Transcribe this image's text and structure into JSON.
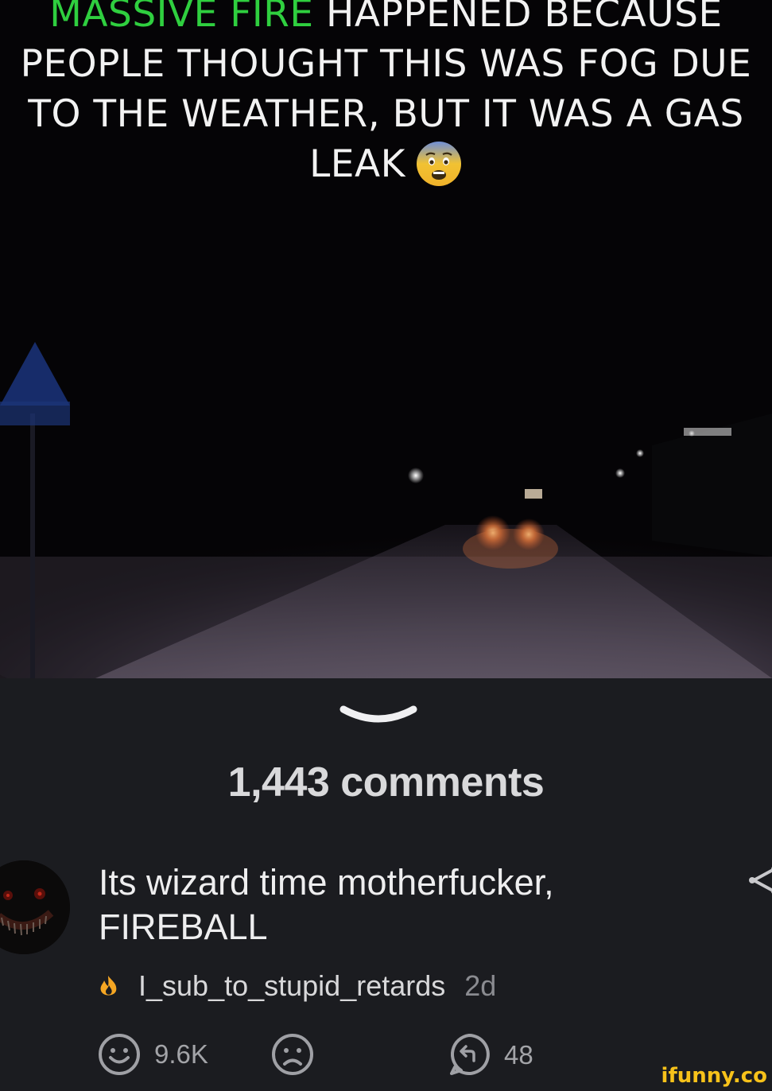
{
  "caption": {
    "line1_green": "MASSIVE FIRE",
    "line1_rest": " HAPPENED BECAUSE",
    "line2": "PEOPLE THOUGHT THIS WAS FOG DUE",
    "line3": "TO THE WEATHER, BUT IT WAS A GAS",
    "line4": "LEAK",
    "emoji": "fearful-face-icon"
  },
  "comments": {
    "count_label": "1,443 comments"
  },
  "comment": {
    "text_line1": "Its wizard time motherfucker,",
    "text_line2": "FIREBALL",
    "username": "I_sub_to_stupid_retards",
    "age": "2d",
    "smile_count": "9.6K",
    "reply_count": "48"
  },
  "watermark": "ifunny.co",
  "colors": {
    "background": "#1b1c20",
    "caption_green": "#2fcf3f",
    "watermark": "#f7c21a",
    "flame": "#f5a623"
  }
}
